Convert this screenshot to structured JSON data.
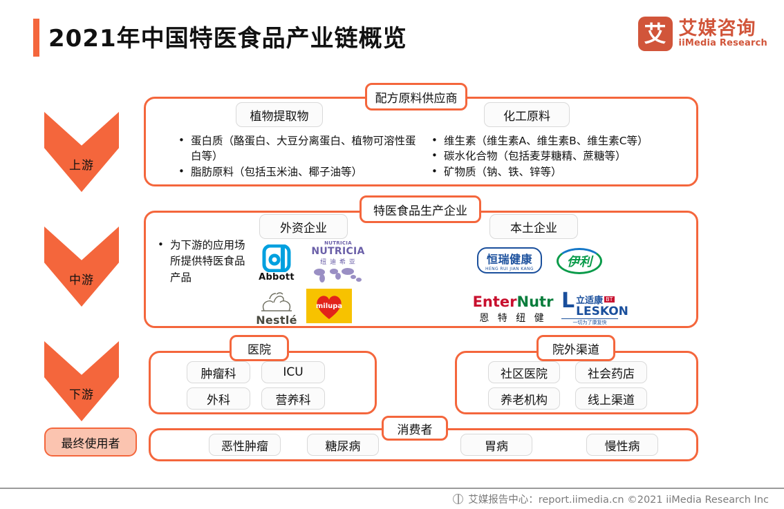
{
  "header": {
    "title": "2021年中国特医食品产业链概览",
    "logo_mark": "艾",
    "logo_cn": "艾媒咨询",
    "logo_en": "iiMedia Research"
  },
  "stages": [
    {
      "label": "上游"
    },
    {
      "label": "中游"
    },
    {
      "label": "下游"
    }
  ],
  "end_user_label": "最终使用者",
  "upstream": {
    "badge": "配方原料供应商",
    "left": {
      "tag": "植物提取物",
      "bullets": [
        "蛋白质（酪蛋白、大豆分离蛋白、植物可溶性蛋白等）",
        "脂肪原料（包括玉米油、椰子油等）"
      ]
    },
    "right": {
      "tag": "化工原料",
      "bullets": [
        "维生素（维生素A、维生素B、维生素C等）",
        "碳水化合物（包括麦芽糖精、蔗糖等）",
        "矿物质（钠、铁、锌等）"
      ]
    }
  },
  "midstream": {
    "badge": "特医食品生产企业",
    "bullet": "为下游的应用场所提供特医食品产品",
    "foreign": {
      "tag": "外资企业",
      "brands": [
        {
          "name": "abbott",
          "caption": "Abbott",
          "mark": "a",
          "color": "#00a0df"
        },
        {
          "name": "nutricia",
          "caption": "NUTRICIA",
          "subcaption": "纽 迪 希 亚",
          "top": "NUTRICIA",
          "color": "#6a5fa8"
        },
        {
          "name": "nestle",
          "caption": "Nestlé",
          "color": "#6e6e60"
        },
        {
          "name": "milupa",
          "caption": "milupa",
          "color": "#f7c200"
        }
      ]
    },
    "domestic": {
      "tag": "本土企业",
      "brands": [
        {
          "name": "hengrui",
          "caption": "恒瑞健康",
          "subcaption": "HENG RUI JIAN KANG",
          "color": "#1a4f9c"
        },
        {
          "name": "yili",
          "caption": "伊利",
          "color": "#0a9b4a"
        },
        {
          "name": "enternutr",
          "caption": "EnterNutr",
          "subcaption": "恩 特 纽 健",
          "color": "#c8102e"
        },
        {
          "name": "leskon",
          "caption": "LESKON",
          "subcaption": "立适康",
          "tagline": "一切为了康复快",
          "color": "#1a4f9c"
        }
      ]
    }
  },
  "downstream": {
    "hospital": {
      "badge": "医院",
      "items": [
        "肿瘤科",
        "ICU",
        "外科",
        "营养科"
      ]
    },
    "offsite": {
      "badge": "院外渠道",
      "items": [
        "社区医院",
        "社会药店",
        "养老机构",
        "线上渠道"
      ]
    }
  },
  "consumer": {
    "badge": "消费者",
    "items": [
      "恶性肿瘤",
      "糖尿病",
      "胃病",
      "慢性病"
    ]
  },
  "footer": {
    "text": "艾媒报告中心：report.iimedia.cn   ©2021   iiMedia Research Inc"
  },
  "colors": {
    "accent": "#f4663c",
    "brand": "#d1553a",
    "pink": "#fbc4b0",
    "gray_border": "#d9d9d9"
  }
}
